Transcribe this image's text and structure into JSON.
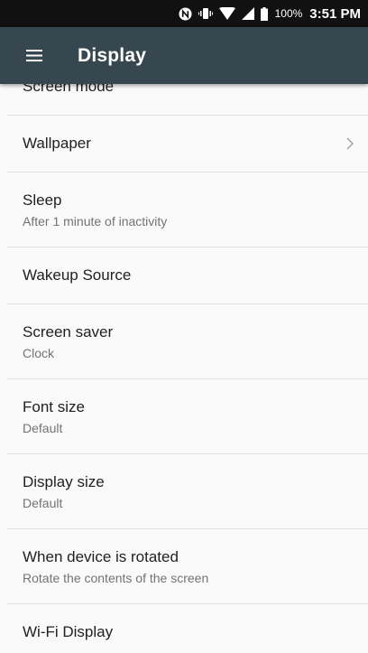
{
  "status_bar": {
    "icons": [
      "nfc-icon",
      "vibrate-icon",
      "wifi-icon",
      "signal-icon",
      "battery-icon"
    ],
    "battery": "100%",
    "time": "3:51 PM"
  },
  "app_bar": {
    "menu_icon": "hamburger-menu-icon",
    "title": "Display",
    "color": "#37474f"
  },
  "settings": {
    "items": [
      {
        "label": "Screen mode"
      },
      {
        "label": "Wallpaper"
      },
      {
        "label": "Sleep",
        "summary": "After 1 minute of inactivity"
      },
      {
        "label": "Wakeup Source"
      },
      {
        "label": "Screen saver",
        "summary": "Clock"
      },
      {
        "label": "Font size",
        "summary": "Default"
      },
      {
        "label": "Display size",
        "summary": "Default"
      },
      {
        "label": "When device is rotated",
        "summary": "Rotate the contents of the screen"
      },
      {
        "label": "Wi-Fi Display"
      }
    ]
  }
}
